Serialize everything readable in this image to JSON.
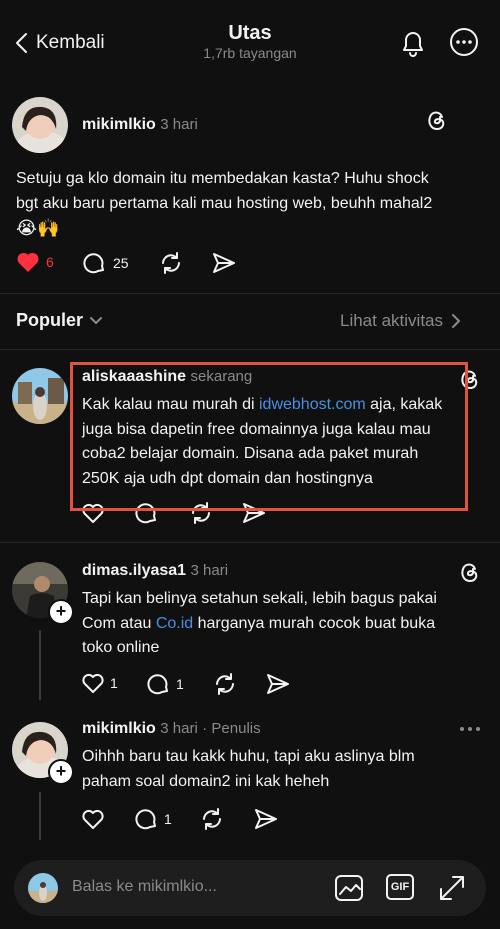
{
  "header": {
    "back_label": "Kembali",
    "title": "Utas",
    "subtitle": "1,7rb tayangan"
  },
  "main_post": {
    "username": "mikimlkio",
    "time": "3 hari",
    "text_line1": "Setuju ga klo domain itu membedakan kasta? Huhu shock",
    "text_line2": "bgt aku baru pertama kali mau hosting web, beuhh mahal2",
    "emoji": "😭🙌",
    "likes": "6",
    "replies": "25"
  },
  "sort": {
    "label": "Populer",
    "activity_label": "Lihat aktivitas"
  },
  "replies": [
    {
      "username": "aliskaaashine",
      "time": "sekarang",
      "line1_pre": "Kak kalau mau murah di ",
      "line1_link": "idwebhost.com",
      "line1_post": " aja, kakak",
      "line2": "juga bisa dapetin free domainnya juga kalau mau",
      "line3": "coba2 belajar domain. Disana ada paket murah",
      "line4": "250K aja udh dpt domain dan hostingnya"
    },
    {
      "username": "dimas.ilyasa1",
      "time": "3 hari",
      "line1": "Tapi kan belinya setahun sekali, lebih bagus pakai",
      "line2_pre": "Com atau ",
      "line2_link": "Co.id",
      "line2_post": " harganya murah cocok buat buka",
      "line3": "toko online",
      "likes": "1",
      "replies": "1"
    },
    {
      "username": "mikimlkio",
      "time": "3 hari",
      "author_tag": "· Penulis",
      "line1": "Oihhh baru tau kakk huhu, tapi aku aslinya blm",
      "line2": "paham soal domain2 ini kak heheh",
      "replies": "1"
    }
  ],
  "composer": {
    "placeholder": "Balas ke mikimlkio...",
    "gif_label": "GIF"
  },
  "colors": {
    "background": "#101010",
    "like_red": "#ff3040",
    "link_blue": "#4a8fe7",
    "highlight_box": "#e2533f"
  }
}
